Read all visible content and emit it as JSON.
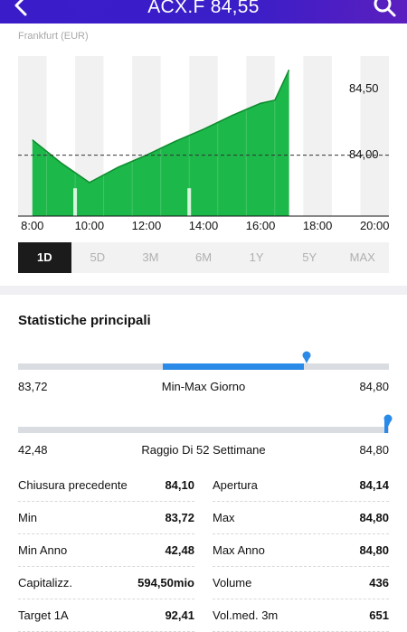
{
  "header": {
    "title": "ACX.F  84,55"
  },
  "exchange": "Frankfurt (EUR)",
  "chart_data": {
    "type": "area",
    "x": [
      "8:00",
      "9:00",
      "10:00",
      "11:00",
      "12:00",
      "13:00",
      "14:00",
      "15:00",
      "16:00",
      "16:30",
      "17:00"
    ],
    "y": [
      84.2,
      84.05,
      83.92,
      84.02,
      84.1,
      84.19,
      84.27,
      84.36,
      84.44,
      84.46,
      84.66
    ],
    "previous_close": 84.1,
    "ylim": [
      83.72,
      84.8
    ],
    "y_ticks": [
      "84,50",
      "84,00"
    ],
    "x_ticks": [
      "8:00",
      "10:00",
      "12:00",
      "14:00",
      "16:00",
      "18:00",
      "20:00"
    ],
    "volume_bars": [
      {
        "x": "9:30",
        "v": 0.55
      },
      {
        "x": "13:30",
        "v": 0.55
      }
    ],
    "colors": {
      "fill": "#1cb84a",
      "line": "#0f8a2e",
      "ref_line": "#333333"
    }
  },
  "ranges": [
    "1D",
    "5D",
    "3M",
    "6M",
    "1Y",
    "5Y",
    "MAX"
  ],
  "active_range": "1D",
  "stats": {
    "title": "Statistiche principali",
    "day_range": {
      "low": "83,72",
      "label": "Min-Max Giorno",
      "high": "84,80",
      "fill_start": 0.39,
      "fill_end": 0.77
    },
    "year_range": {
      "low": "42,48",
      "label": "Raggio Di 52 Settimane",
      "high": "84,80",
      "marker": 0.99
    },
    "left": [
      {
        "label": "Chiusura precedente",
        "value": "84,10"
      },
      {
        "label": "Min",
        "value": "83,72"
      },
      {
        "label": "Min Anno",
        "value": "42,48"
      },
      {
        "label": "Capitalizz.",
        "value": "594,50mio"
      },
      {
        "label": "Target 1A",
        "value": "92,41"
      }
    ],
    "right": [
      {
        "label": "Apertura",
        "value": "84,14"
      },
      {
        "label": "Max",
        "value": "84,80"
      },
      {
        "label": "Max Anno",
        "value": "84,80"
      },
      {
        "label": "Volume",
        "value": "436"
      },
      {
        "label": "Vol.med. 3m",
        "value": "651"
      }
    ]
  }
}
